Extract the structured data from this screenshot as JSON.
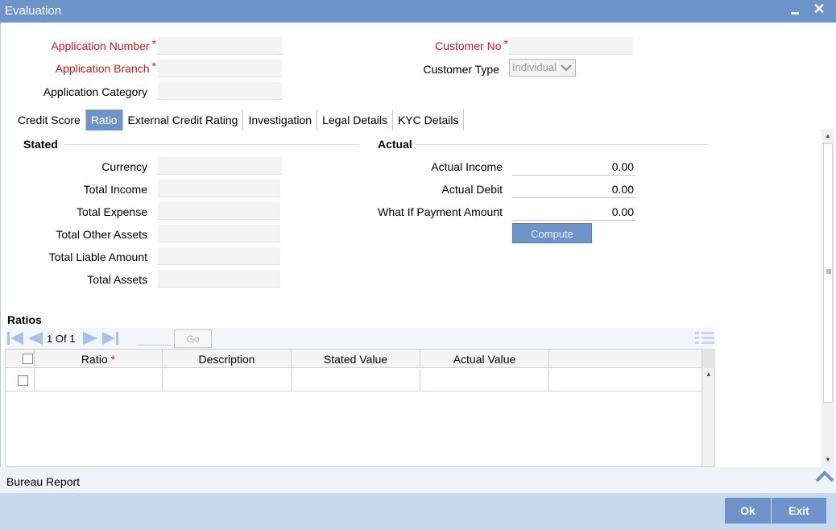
{
  "window": {
    "title": "Evaluation",
    "minimize_icon": "minimize-icon",
    "close_icon": "close-icon"
  },
  "header": {
    "application_number_label": "Application Number",
    "application_branch_label": "Application Branch",
    "application_category_label": "Application Category",
    "customer_no_label": "Customer No",
    "customer_type_label": "Customer Type",
    "customer_type_value": "Individual",
    "required_mark": "*"
  },
  "tabs": [
    {
      "label": "Credit Score",
      "active": false
    },
    {
      "label": "Ratio",
      "active": true
    },
    {
      "label": "External Credit Rating",
      "active": false
    },
    {
      "label": "Investigation",
      "active": false
    },
    {
      "label": "Legal Details",
      "active": false
    },
    {
      "label": "KYC Details",
      "active": false
    }
  ],
  "stated": {
    "heading": "Stated",
    "fields": [
      {
        "label": "Currency",
        "value": ""
      },
      {
        "label": "Total Income",
        "value": ""
      },
      {
        "label": "Total Expense",
        "value": ""
      },
      {
        "label": "Total Other Assets",
        "value": ""
      },
      {
        "label": "Total Liable Amount",
        "value": ""
      },
      {
        "label": "Total Assets",
        "value": ""
      }
    ]
  },
  "actual": {
    "heading": "Actual",
    "fields": [
      {
        "label": "Actual Income",
        "value": "0.00"
      },
      {
        "label": "Actual Debit",
        "value": "0.00"
      },
      {
        "label": "What If Payment Amount",
        "value": "0.00"
      }
    ],
    "compute_label": "Compute"
  },
  "ratios": {
    "heading": "Ratios",
    "pager": {
      "current": "1",
      "of_label": "Of",
      "total": "1",
      "go_label": "Go"
    },
    "columns": [
      "Ratio",
      "Description",
      "Stated Value",
      "Actual Value"
    ],
    "rows": [
      {
        "ratio": "",
        "description": "",
        "stated_value": "",
        "actual_value": ""
      }
    ]
  },
  "bureau": {
    "label": "Bureau Report"
  },
  "footer": {
    "ok_label": "Ok",
    "exit_label": "Exit"
  },
  "colors": {
    "accent": "#6d93c9",
    "required": "#d21a1a",
    "footer_bg": "#c7d9ef"
  }
}
